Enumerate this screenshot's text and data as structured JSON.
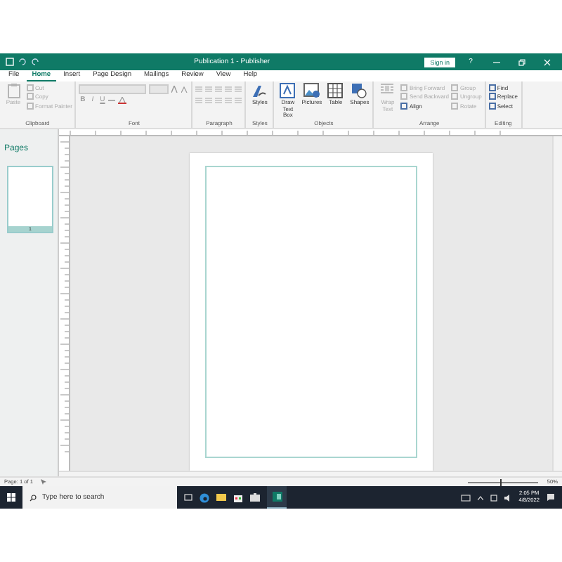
{
  "window": {
    "title": "Publication 1 - Publisher",
    "sign_in": "Sign in",
    "help": "?"
  },
  "tabs": [
    {
      "label": "File",
      "selected": false
    },
    {
      "label": "Home",
      "selected": true
    },
    {
      "label": "Insert",
      "selected": false
    },
    {
      "label": "Page Design",
      "selected": false
    },
    {
      "label": "Mailings",
      "selected": false
    },
    {
      "label": "Review",
      "selected": false
    },
    {
      "label": "View",
      "selected": false
    },
    {
      "label": "Help",
      "selected": false
    }
  ],
  "ribbon": {
    "groups": [
      {
        "name": "Clipboard",
        "items": [
          {
            "kind": "large",
            "label": "Paste",
            "disabled": true
          },
          {
            "kind": "small",
            "label": "Cut",
            "disabled": true
          },
          {
            "kind": "small",
            "label": "Copy",
            "disabled": true
          },
          {
            "kind": "small",
            "label": "Format Painter",
            "disabled": true
          }
        ]
      },
      {
        "name": "Font",
        "kind": "font",
        "format_buttons": [
          "B",
          "I",
          "U"
        ]
      },
      {
        "name": "Paragraph",
        "kind": "paragraph"
      },
      {
        "name": "Styles",
        "items": [
          {
            "kind": "large",
            "label": "Styles",
            "disabled": false
          }
        ]
      },
      {
        "name": "Objects",
        "items": [
          {
            "kind": "large",
            "label": "Draw Text Box",
            "disabled": false
          },
          {
            "kind": "large",
            "label": "Pictures",
            "disabled": false
          },
          {
            "kind": "large",
            "label": "Table",
            "disabled": false
          },
          {
            "kind": "large",
            "label": "Shapes",
            "disabled": false
          }
        ]
      },
      {
        "name": "Arrange",
        "items": [
          {
            "kind": "large",
            "label": "Wrap Text",
            "disabled": true
          },
          {
            "kind": "small",
            "label": "Bring Forward",
            "disabled": true
          },
          {
            "kind": "small",
            "label": "Send Backward",
            "disabled": true
          },
          {
            "kind": "small",
            "label": "Align",
            "disabled": false
          },
          {
            "kind": "small",
            "label": "Group",
            "disabled": true
          },
          {
            "kind": "small",
            "label": "Ungroup",
            "disabled": true
          },
          {
            "kind": "small",
            "label": "Rotate",
            "disabled": true
          }
        ]
      },
      {
        "name": "Editing",
        "items": [
          {
            "kind": "small",
            "label": "Find",
            "disabled": false
          },
          {
            "kind": "small",
            "label": "Replace",
            "disabled": false
          },
          {
            "kind": "small",
            "label": "Select",
            "disabled": false
          }
        ]
      }
    ]
  },
  "pages_pane": {
    "title": "Pages",
    "pages": [
      {
        "number": "1",
        "selected": true
      }
    ]
  },
  "status_bar": {
    "page": "Page: 1 of 1",
    "zoom": "50%",
    "zoom_slider": {
      "level": 0.45
    }
  },
  "taskbar": {
    "search_placeholder": "Type here to search",
    "time": "2:05 PM",
    "date": "4/8/2022"
  }
}
